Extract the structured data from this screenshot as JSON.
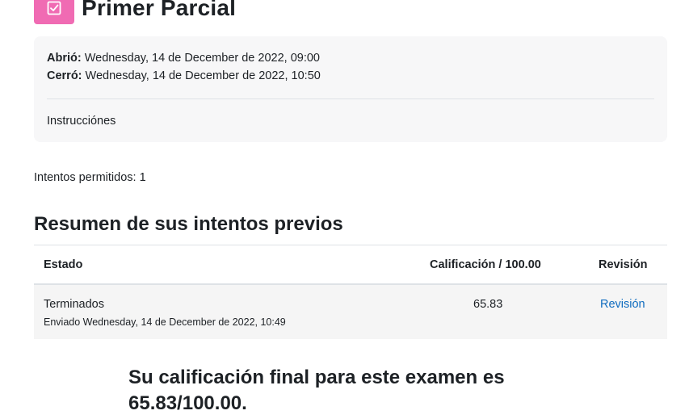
{
  "header": {
    "icon": "quiz-checkbox-icon",
    "icon_color": "#f06bb3",
    "title": "Primer Parcial"
  },
  "dates": {
    "opened_label": "Abrió:",
    "opened_value": "Wednesday, 14 de December de 2022, 09:00",
    "closed_label": "Cerró:",
    "closed_value": "Wednesday, 14 de December de 2022, 10:50",
    "instructions": "Instrucciónes"
  },
  "attempts_allowed": "Intentos permitidos: 1",
  "summary": {
    "title": "Resumen de sus intentos previos",
    "columns": [
      "Estado",
      "Calificación / 100.00",
      "Revisión"
    ],
    "rows": [
      {
        "state": "Terminados",
        "submitted": "Enviado Wednesday, 14 de December de 2022, 10:49",
        "grade": "65.83",
        "review_link": "Revisión"
      }
    ]
  },
  "final_grade": "Su calificación final para este examen es 65.83/100.00.",
  "colors": {
    "link": "#0f6cbf",
    "panel_bg": "#f7f7f8",
    "row_bg": "#f5f5f5"
  }
}
